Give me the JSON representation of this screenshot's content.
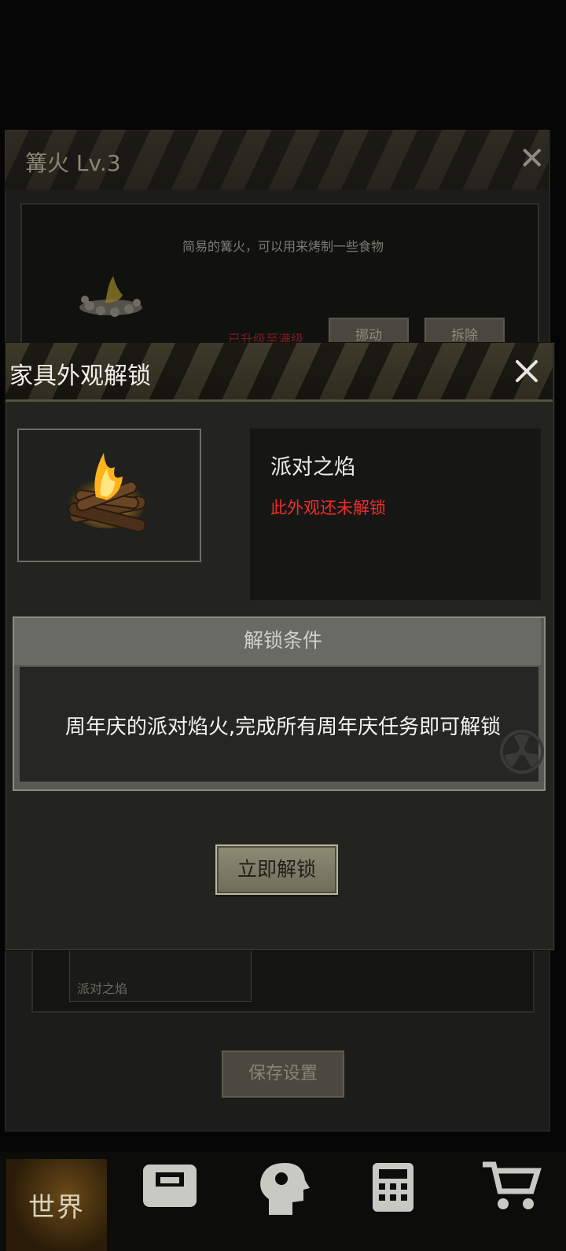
{
  "background_panel": {
    "title": "篝火 Lv.3",
    "description": "简易的篝火，可以用来烤制一些食物",
    "status_text": "已升级至满级",
    "move_button": "挪动",
    "demolish_button": "拆除",
    "skin_label": "派对之焰",
    "save_button": "保存设置"
  },
  "modal": {
    "title": "家具外观解锁",
    "skin_name": "派对之焰",
    "lock_status": "此外观还未解锁",
    "condition_title": "解锁条件",
    "condition_text": "周年庆的派对焰火,完成所有周年庆任务即可解锁",
    "unlock_button": "立即解锁"
  },
  "nav": {
    "world_label": "世界",
    "icons": [
      "backpack-icon",
      "head-gear-icon",
      "calculator-icon",
      "cart-icon"
    ]
  },
  "colors": {
    "locked_red": "#ee2d2d",
    "panel_bg": "#232420",
    "stripe_dark": "#2f2c20"
  }
}
